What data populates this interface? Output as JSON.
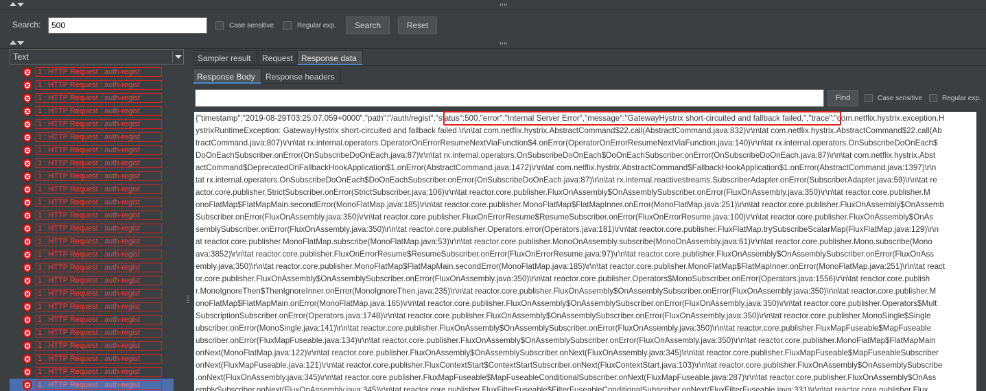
{
  "search": {
    "label": "Search:",
    "value": "500",
    "case_sensitive_label": "Case sensitive",
    "regex_label": "Regular exp.",
    "search_button": "Search",
    "reset_button": "Reset"
  },
  "left_panel": {
    "header": "Text",
    "items": [
      {
        "label": "1 : HTTP Request : auth-regist"
      },
      {
        "label": "1 : HTTP Request : auth-regist"
      },
      {
        "label": "1 : HTTP Request : auth-regist"
      },
      {
        "label": "1 : HTTP Request : auth-regist"
      },
      {
        "label": "1 : HTTP Request : auth-regist"
      },
      {
        "label": "1 : HTTP Request : auth-regist"
      },
      {
        "label": "1 : HTTP Request : auth-regist"
      },
      {
        "label": "1 : HTTP Request : auth-regist"
      },
      {
        "label": "1 : HTTP Request : auth-regist"
      },
      {
        "label": "1 : HTTP Request : auth-regist"
      },
      {
        "label": "1 : HTTP Request : auth-regist"
      },
      {
        "label": "1 : HTTP Request : auth-regist"
      },
      {
        "label": "1 : HTTP Request : auth-regist"
      },
      {
        "label": "1 : HTTP Request : auth-regist"
      },
      {
        "label": "1 : HTTP Request : auth-regist"
      },
      {
        "label": "1 : HTTP Request : auth-regist"
      },
      {
        "label": "1 : HTTP Request : auth-regist"
      },
      {
        "label": "1 : HTTP Request : auth-regist"
      },
      {
        "label": "1 : HTTP Request : auth-regist"
      },
      {
        "label": "1 : HTTP Request : auth-regist"
      },
      {
        "label": "1 : HTTP Request : auth-regist"
      },
      {
        "label": "1 : HTTP Request : auth-regist"
      },
      {
        "label": "1 : HTTP Request : auth-regist"
      },
      {
        "label": "1 : HTTP Request : auth-regist"
      },
      {
        "label": "1 : HTTP Request : auth-regist"
      },
      {
        "label": "1 : HTTP Request : auth-regist"
      }
    ],
    "selected_index": 24
  },
  "tabs": [
    {
      "label": "Sampler result",
      "active": false
    },
    {
      "label": "Request",
      "active": false
    },
    {
      "label": "Response data",
      "active": true
    }
  ],
  "subtabs": [
    {
      "label": "Response Body",
      "active": true
    },
    {
      "label": "Response headers",
      "active": false
    }
  ],
  "find": {
    "value": "",
    "find_button": "Find",
    "case_sensitive_label": "Case sensitive",
    "regex_label": "Regular exp."
  },
  "response_lines": [
    "{\"timestamp\":\"2019-08-29T03:25:07.059+0000\",\"path\":\"/auth/regist\",\"status\":500,\"error\":\"Internal Server Error\",\"message\":\"GatewayHystrix short-circuited and fallback failed.\",\"trace\":\"com.netflix.hystrix.exception.H",
    "ystrixRuntimeException: GatewayHystrix short-circuited and fallback failed.\\r\\n\\tat com.netflix.hystrix.AbstractCommand$22.call(AbstractCommand.java:832)\\r\\n\\tat com.netflix.hystrix.AbstractCommand$22.call(Ab",
    "tractCommand.java:807)\\r\\n\\tat rx.internal.operators.OperatorOnErrorResumeNextViaFunction$4.onError(OperatorOnErrorResumeNextViaFunction.java:140)\\r\\n\\tat rx.internal.operators.OnSubscribeDoOnEach$",
    "DoOnEachSubscriber.onError(OnSubscribeDoOnEach.java:87)\\r\\n\\tat rx.internal.operators.OnSubscribeDoOnEach$DoOnEachSubscriber.onError(OnSubscribeDoOnEach.java:87)\\r\\n\\tat com.netflix.hystrix.Abst",
    "actCommand$DeprecatedOnFallbackHookApplication$1.onError(AbstractCommand.java:1472)\\r\\n\\tat com.netflix.hystrix.AbstractCommand$FallbackHookApplication$1.onError(AbstractCommand.java:1397)\\r\\n",
    "tat rx.internal.operators.OnSubscribeDoOnEach$DoOnEachSubscriber.onError(OnSubscribeDoOnEach.java:87)\\r\\n\\tat rx.internal.reactivestreams.SubscriberAdapter.onError(SubscriberAdapter.java:59)\\r\\n\\tat re",
    "actor.core.publisher.StrictSubscriber.onError(StrictSubscriber.java:106)\\r\\n\\tat reactor.core.publisher.FluxOnAssembly$OnAssemblySubscriber.onError(FluxOnAssembly.java:350)\\r\\n\\tat reactor.core.publisher.M",
    "onoFlatMap$FlatMapMain.secondError(MonoFlatMap.java:185)\\r\\n\\tat reactor.core.publisher.MonoFlatMap$FlatMapInner.onError(MonoFlatMap.java:251)\\r\\n\\tat reactor.core.publisher.FluxOnAssembly$OnAssemb",
    "Subscriber.onError(FluxOnAssembly.java:350)\\r\\n\\tat reactor.core.publisher.FluxOnErrorResume$ResumeSubscriber.onError(FluxOnErrorResume.java:100)\\r\\n\\tat reactor.core.publisher.FluxOnAssembly$OnAs",
    "semblySubscriber.onError(FluxOnAssembly.java:350)\\r\\n\\tat reactor.core.publisher.Operators.error(Operators.java:181)\\r\\n\\tat reactor.core.publisher.FluxFlatMap.trySubscribeScalarMap(FluxFlatMap.java:129)\\r\\n",
    "at reactor.core.publisher.MonoFlatMap.subscribe(MonoFlatMap.java:53)\\r\\n\\tat reactor.core.publisher.MonoOnAssembly.subscribe(MonoOnAssembly.java:61)\\r\\n\\tat reactor.core.publisher.Mono.subscribe(Mono",
    "ava:3852)\\r\\n\\tat reactor.core.publisher.FluxOnErrorResume$ResumeSubscriber.onError(FluxOnErrorResume.java:97)\\r\\n\\tat reactor.core.publisher.FluxOnAssembly$OnAssemblySubscriber.onError(FluxOnAss",
    "embly.java:350)\\r\\n\\tat reactor.core.publisher.MonoFlatMap$FlatMapMain.secondError(MonoFlatMap.java:185)\\r\\n\\tat reactor.core.publisher.MonoFlatMap$FlatMapInner.onError(MonoFlatMap.java:251)\\r\\n\\tat react",
    "or.core.publisher.FluxOnAssembly$OnAssemblySubscriber.onError(FluxOnAssembly.java:350)\\r\\n\\tat reactor.core.publisher.Operators$MonoSubscriber.onError(Operators.java:1556)\\r\\n\\tat reactor.core.publish",
    "r.MonoIgnoreThen$ThenIgnoreInner.onError(MonoIgnoreThen.java:235)\\r\\n\\tat reactor.core.publisher.FluxOnAssembly$OnAssemblySubscriber.onError(FluxOnAssembly.java:350)\\r\\n\\tat reactor.core.publisher.M",
    "onoFlatMap$FlatMapMain.onError(MonoFlatMap.java:165)\\r\\n\\tat reactor.core.publisher.FluxOnAssembly$OnAssemblySubscriber.onError(FluxOnAssembly.java:350)\\r\\n\\tat reactor.core.publisher.Operators$Mult",
    "SubscriptionSubscriber.onError(Operators.java:1748)\\r\\n\\tat reactor.core.publisher.FluxOnAssembly$OnAssemblySubscriber.onError(FluxOnAssembly.java:350)\\r\\n\\tat reactor.core.publisher.MonoSingle$Single",
    "ubscriber.onError(MonoSingle.java:141)\\r\\n\\tat reactor.core.publisher.FluxOnAssembly$OnAssemblySubscriber.onError(FluxOnAssembly.java:350)\\r\\n\\tat reactor.core.publisher.FluxMapFuseable$MapFuseable",
    "ubscriber.onError(FluxMapFuseable.java:134)\\r\\n\\tat reactor.core.publisher.FluxOnAssembly$OnAssemblySubscriber.onError(FluxOnAssembly.java:350)\\r\\n\\tat reactor.core.publisher.MonoFlatMap$FlatMapMain",
    "onNext(MonoFlatMap.java:122)\\r\\n\\tat reactor.core.publisher.FluxOnAssembly$OnAssemblySubscriber.onNext(FluxOnAssembly.java:345)\\r\\n\\tat reactor.core.publisher.FluxMapFuseable$MapFuseableSubscriber",
    "onNext(FluxMapFuseable.java:121)\\r\\n\\tat reactor.core.publisher.FluxContextStart$ContextStartSubscriber.onNext(FluxContextStart.java:103)\\r\\n\\tat reactor.core.publisher.FluxOnAssembly$OnAssemblySubscribe",
    ".onNext(FluxOnAssembly.java:345)\\r\\n\\tat reactor.core.publisher.FluxMapFuseable$MapFuseableConditionalSubscriber.onNext(FluxMapFuseable.java:287)\\r\\n\\tat reactor.core.publisher.FluxOnAssembly$OnAss",
    "emblySubscriber.onNext(FluxOnAssembly.java:345)\\r\\n\\tat reactor.core.publisher.FluxFilterFuseable$FilterFuseableConditionalSubscriber.onNext(FluxFilterFuseable.java:331)\\r\\n\\tat reactor.core.publisher.Flux"
  ],
  "colors": {
    "background": "#3c3f41",
    "selection": "#4b6eaf",
    "error_text": "#ff3b30",
    "highlight_border": "#e02020",
    "active_tab_underline": "#4a88c7"
  }
}
